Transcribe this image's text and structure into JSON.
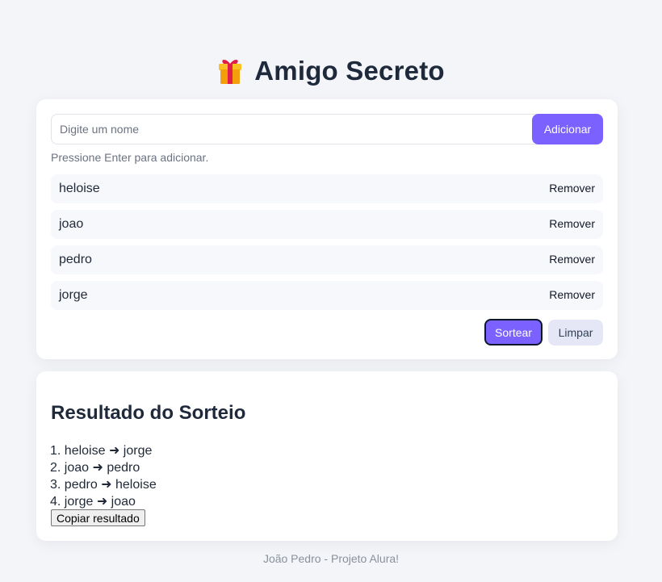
{
  "app": {
    "title": "Amigo Secreto",
    "title_icon": "gift-icon"
  },
  "form": {
    "input_value": "",
    "input_placeholder": "Digite um nome",
    "add_label": "Adicionar",
    "hint": "Pressione Enter para adicionar."
  },
  "participants": [
    {
      "name": "heloise",
      "remove_label": "Remover"
    },
    {
      "name": "joao",
      "remove_label": "Remover"
    },
    {
      "name": "pedro",
      "remove_label": "Remover"
    },
    {
      "name": "jorge",
      "remove_label": "Remover"
    }
  ],
  "actions": {
    "draw_label": "Sortear",
    "clear_label": "Limpar"
  },
  "result": {
    "title": "Resultado do Sorteio",
    "lines": [
      "1. heloise ➜ jorge",
      "2. joao ➜ pedro",
      "3. pedro ➜ heloise",
      "4. jorge ➜ joao"
    ],
    "copy_label": "Copiar resultado"
  },
  "footer": {
    "text": "João Pedro - Projeto Alura!"
  },
  "colors": {
    "accent": "#7b61ff",
    "page_bg": "#f3f5f9",
    "card_bg": "#ffffff",
    "item_bg": "#f7f8fb",
    "secondary_button_bg": "#e5e7f7"
  }
}
